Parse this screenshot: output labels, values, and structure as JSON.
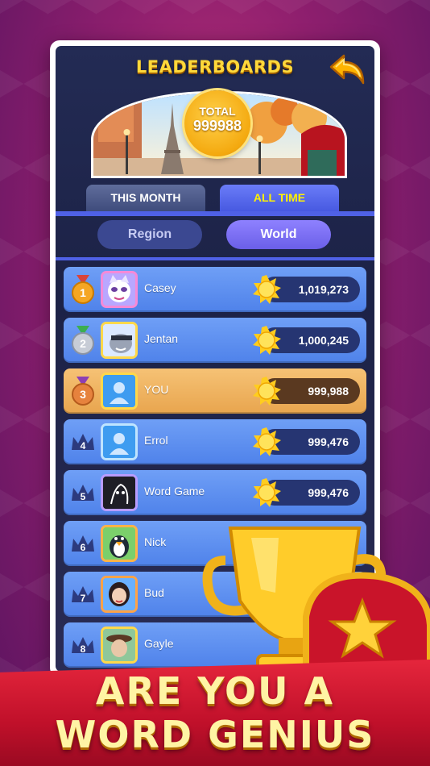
{
  "header": {
    "title": "LEADERBOARDS",
    "total_label": "TOTAL",
    "total_value": "999988"
  },
  "tabs": [
    {
      "label": "THIS MONTH",
      "active": false
    },
    {
      "label": "ALL TIME",
      "active": true
    }
  ],
  "scope": [
    {
      "label": "Region",
      "active": false
    },
    {
      "label": "World",
      "active": true
    }
  ],
  "rows": [
    {
      "rank": "1",
      "name": "Casey",
      "score": "1,019,273"
    },
    {
      "rank": "2",
      "name": "Jentan",
      "score": "1,000,245"
    },
    {
      "rank": "3",
      "name": "YOU",
      "score": "999,988"
    },
    {
      "rank": "4",
      "name": "Errol",
      "score": "999,476"
    },
    {
      "rank": "5",
      "name": "Word Game",
      "score": "999,476"
    },
    {
      "rank": "6",
      "name": "Nick",
      "score": ""
    },
    {
      "rank": "7",
      "name": "Bud",
      "score": ""
    },
    {
      "rank": "8",
      "name": "Gayle",
      "score": ""
    }
  ],
  "slogan": {
    "line1": "ARE YOU A",
    "line2": "WORD GENIUS"
  },
  "colors": {
    "background": "#a52874",
    "panel": "#1f2649",
    "row": "#5d8ff0",
    "row_self": "#eeb060",
    "gold": "#ffd83a",
    "ribbon": "#d01a33"
  },
  "icons": [
    "back-arrow-icon",
    "coin-icon",
    "gold-medal-icon",
    "silver-medal-icon",
    "bronze-medal-icon",
    "crown-icon",
    "trophy-icon",
    "treasure-chest-icon"
  ]
}
